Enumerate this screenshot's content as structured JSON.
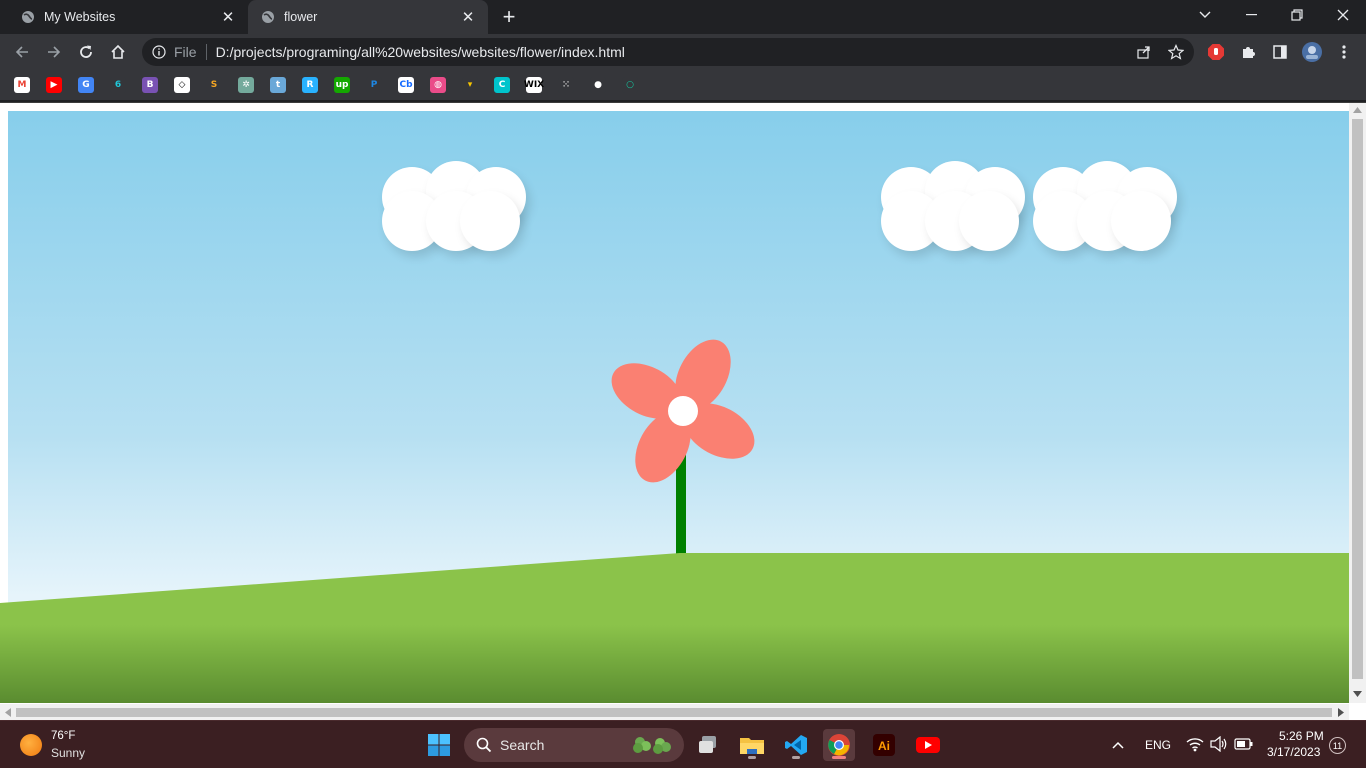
{
  "browser": {
    "tabs": [
      {
        "title": "My Websites",
        "active": false
      },
      {
        "title": "flower",
        "active": true
      }
    ],
    "address": {
      "scheme_label": "File",
      "url": "D:/projects/programing/all%20websites/websites/flower/index.html"
    },
    "bookmarks": [
      {
        "icon": "gmail-icon",
        "glyph": "M",
        "color": "#ffffff",
        "fg": "#ea4335"
      },
      {
        "icon": "youtube-icon",
        "glyph": "▶",
        "color": "#ff0000",
        "fg": "#ffffff"
      },
      {
        "icon": "google-translate-icon",
        "glyph": "G",
        "color": "#4285f4",
        "fg": "#ffffff"
      },
      {
        "icon": "spiral-icon",
        "glyph": "6",
        "color": "#35363a",
        "fg": "#21c7d9"
      },
      {
        "icon": "bootstrap-icon",
        "glyph": "B",
        "color": "#7952b3",
        "fg": "#ffffff"
      },
      {
        "icon": "codepen-icon",
        "glyph": "◇",
        "color": "#ffffff",
        "fg": "#000000"
      },
      {
        "icon": "sololearn-icon",
        "glyph": "S",
        "color": "#35363a",
        "fg": "#f5a623"
      },
      {
        "icon": "chatgpt-icon",
        "glyph": "✲",
        "color": "#74aa9c",
        "fg": "#ffffff"
      },
      {
        "icon": "tumblr-icon",
        "glyph": "t",
        "color": "#6aa8d8",
        "fg": "#ffffff"
      },
      {
        "icon": "freelancer-icon",
        "glyph": "R",
        "color": "#29b2fe",
        "fg": "#ffffff"
      },
      {
        "icon": "upwork-icon",
        "glyph": "up",
        "color": "#14a800",
        "fg": "#ffffff"
      },
      {
        "icon": "paypal-icon",
        "glyph": "P",
        "color": "#35363a",
        "fg": "#1e88e5"
      },
      {
        "icon": "crunchbase-icon",
        "glyph": "Cb",
        "color": "#ffffff",
        "fg": "#146aff"
      },
      {
        "icon": "dribbble-icon",
        "glyph": "◍",
        "color": "#ea4c89",
        "fg": "#ffffff"
      },
      {
        "icon": "shield-flag-icon",
        "glyph": "▾",
        "color": "#35363a",
        "fg": "#f7c600"
      },
      {
        "icon": "canva-icon",
        "glyph": "C",
        "color": "#00c4cc",
        "fg": "#ffffff"
      },
      {
        "icon": "wix-icon",
        "glyph": "WIX",
        "color": "#ffffff",
        "fg": "#000000"
      },
      {
        "icon": "dots-grid-icon",
        "glyph": "⁙",
        "color": "#35363a",
        "fg": "#cfcfcf"
      },
      {
        "icon": "github-icon",
        "glyph": "●",
        "color": "#35363a",
        "fg": "#ffffff"
      },
      {
        "icon": "ring-icon",
        "glyph": "○",
        "color": "#35363a",
        "fg": "#14c8a0"
      }
    ]
  },
  "scene": {
    "sky_color": "#87ceeb",
    "cloud_color": "#ffffff",
    "petal_color": "#fa8072",
    "stem_color": "#008000",
    "grass_color": "#8bc34a"
  },
  "taskbar": {
    "weather": {
      "temp": "76°F",
      "desc": "Sunny"
    },
    "search_label": "Search",
    "apps": [
      "start-icon",
      "task-view-icon",
      "file-explorer-icon",
      "vscode-icon",
      "chrome-icon",
      "illustrator-icon",
      "youtube-app-icon"
    ],
    "language": "ENG",
    "time": "5:26 PM",
    "date": "3/17/2023",
    "notifications": "11"
  }
}
